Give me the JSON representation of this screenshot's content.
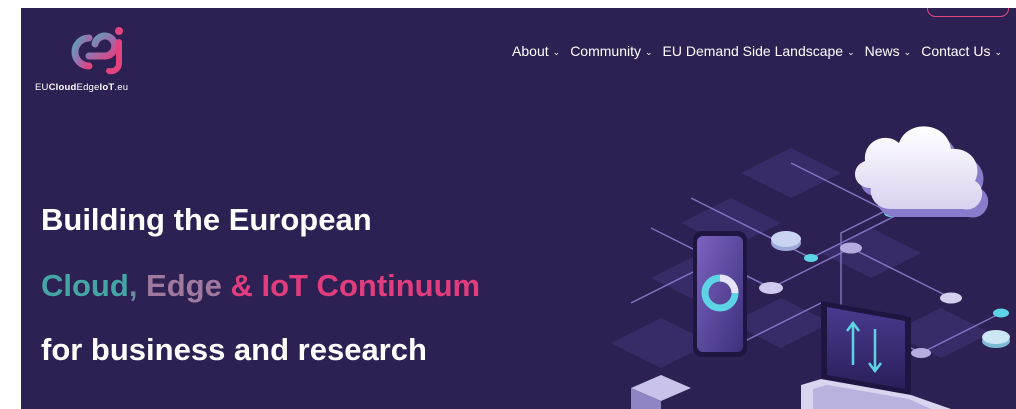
{
  "logo": {
    "text_prefix": "EU",
    "text_bold1": "Cloud",
    "text_mid": "Edge",
    "text_bold2": "IoT",
    "text_suffix": ".eu"
  },
  "nav": {
    "items": [
      {
        "label": "About"
      },
      {
        "label": "Community"
      },
      {
        "label": "EU Demand Side Landscape"
      },
      {
        "label": "News"
      },
      {
        "label": "Contact Us"
      }
    ],
    "chevron": "⌄"
  },
  "hero": {
    "line1": "Building the European",
    "line2_cloud": "Cloud",
    "line2_comma": ",",
    "line2_edge": " Edge",
    "line2_rest": " & IoT Continuum",
    "line3": "for business and research"
  },
  "colors": {
    "background": "#2c2152",
    "accent_pink": "#e13d7e",
    "accent_teal": "#45a5a5"
  }
}
